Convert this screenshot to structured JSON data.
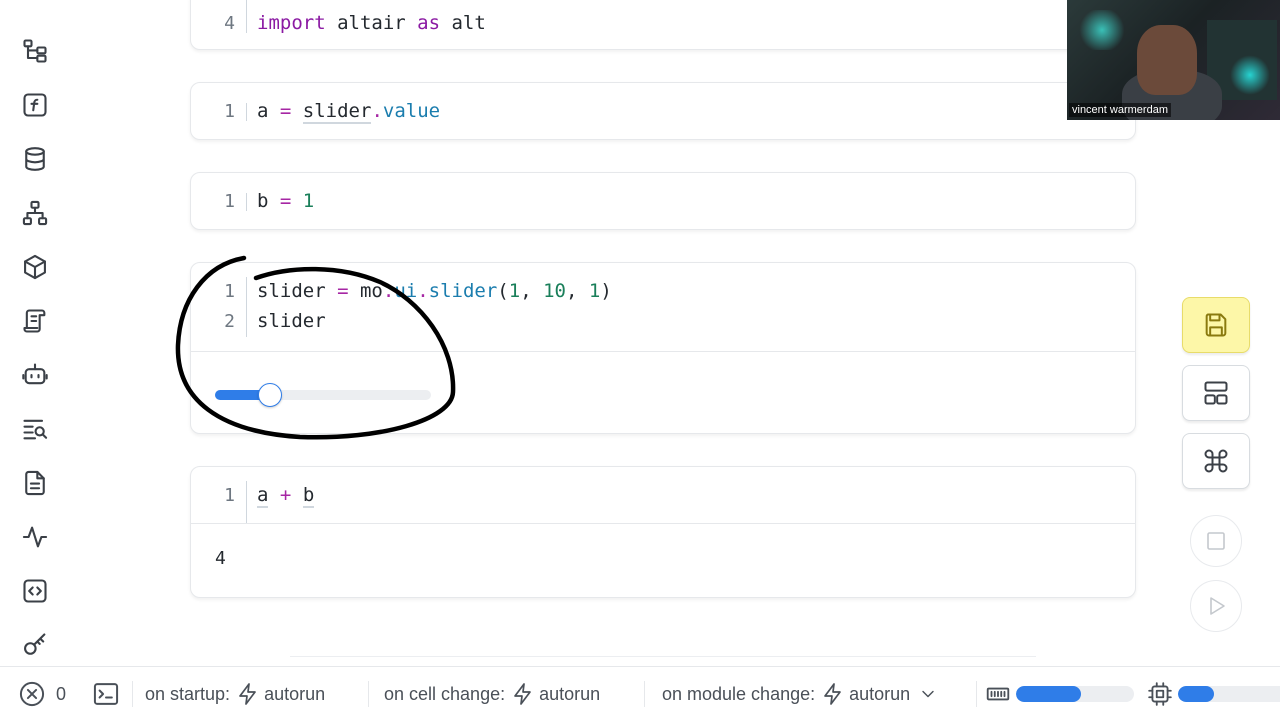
{
  "cells": [
    {
      "lines": [
        {
          "num": "4",
          "code": "import altair as alt"
        }
      ]
    },
    {
      "lines": [
        {
          "num": "1",
          "code": "a = slider.value"
        }
      ]
    },
    {
      "lines": [
        {
          "num": "1",
          "code": "b = 1"
        }
      ]
    },
    {
      "lines": [
        {
          "num": "1",
          "code": "slider = mo.ui.slider(1, 10, 1)"
        },
        {
          "num": "2",
          "code": "slider"
        }
      ],
      "slider": {
        "min": 1,
        "max": 10,
        "step": 1,
        "value": 3
      }
    },
    {
      "lines": [
        {
          "num": "1",
          "code": "a + b"
        }
      ],
      "output": "4"
    }
  ],
  "video": {
    "name": "vincent warmerdam"
  },
  "statusbar": {
    "error_count": "0",
    "startup_label": "on startup:",
    "startup_value": "autorun",
    "cell_change_label": "on cell change:",
    "cell_change_value": "autorun",
    "module_change_label": "on module change:",
    "module_change_value": "autorun",
    "memory_fraction": 0.55,
    "cpu_fraction": 0.35
  },
  "colors": {
    "accent": "#2f7de8",
    "save_button": "#fdf7a8"
  }
}
